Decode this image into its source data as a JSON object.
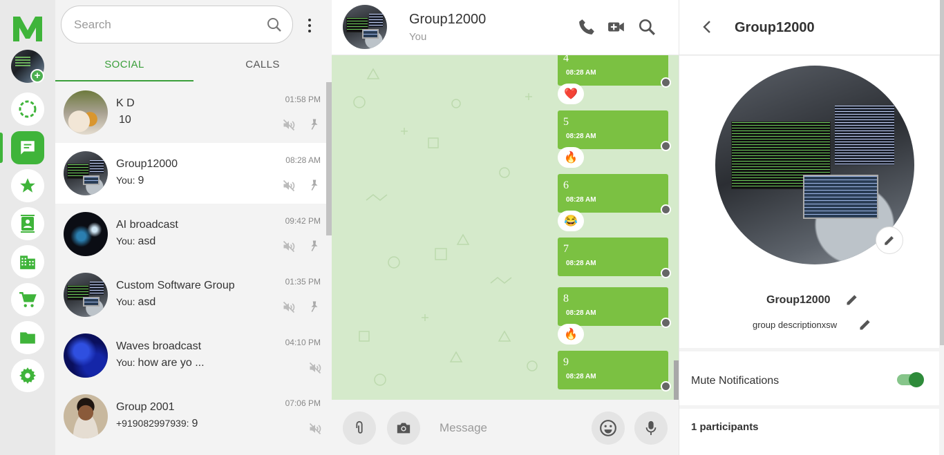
{
  "colors": {
    "brand_green": "#3fb43a",
    "bubble_green": "#7bc142",
    "chat_bg": "#d5eacb",
    "panel_bg": "#f3f3f3"
  },
  "rail": {
    "logo_letter": "M",
    "items": [
      {
        "icon": "status-ring-icon"
      },
      {
        "icon": "chat-icon",
        "active": true
      },
      {
        "icon": "star-icon"
      },
      {
        "icon": "contacts-icon"
      },
      {
        "icon": "building-icon"
      },
      {
        "icon": "cart-icon"
      },
      {
        "icon": "folder-icon"
      },
      {
        "icon": "gear-icon"
      }
    ]
  },
  "search": {
    "placeholder": "Search"
  },
  "tabs": {
    "social": "SOCIAL",
    "calls": "CALLS"
  },
  "conversations": [
    {
      "name": "K D",
      "you": "",
      "preview": "10",
      "time": "01:58 PM",
      "muted": true,
      "pinned": true
    },
    {
      "name": "Group12000",
      "you": "You:",
      "preview": "9",
      "time": "08:28 AM",
      "muted": true,
      "pinned": true,
      "selected": true
    },
    {
      "name": "AI broadcast",
      "you": "You:",
      "preview": "asd",
      "time": "09:42 PM",
      "muted": true,
      "pinned": true
    },
    {
      "name": "Custom Software Group",
      "you": "You:",
      "preview": "asd",
      "time": "01:35 PM",
      "muted": true,
      "pinned": true
    },
    {
      "name": "Waves broadcast",
      "you": "You:",
      "preview": "how are yo ...",
      "time": "04:10 PM",
      "muted": true,
      "pinned": false
    },
    {
      "name": "Group 2001",
      "you": "+919082997939:",
      "preview": "9",
      "time": "07:06 PM",
      "muted": true,
      "pinned": false
    }
  ],
  "chat": {
    "title": "Group12000",
    "subtitle": "You",
    "messages": [
      {
        "text": "4",
        "time": "08:28 AM",
        "reaction": "❤️"
      },
      {
        "text": "5",
        "time": "08:28 AM",
        "reaction": "🔥"
      },
      {
        "text": "6",
        "time": "08:28 AM",
        "reaction": "😂"
      },
      {
        "text": "7",
        "time": "08:28 AM",
        "reaction": ""
      },
      {
        "text": "8",
        "time": "08:28 AM",
        "reaction": "🔥"
      },
      {
        "text": "9",
        "time": "08:28 AM",
        "reaction": ""
      }
    ],
    "composer_placeholder": "Message"
  },
  "info": {
    "title": "Group12000",
    "group_name": "Group12000",
    "group_description": "group descriptionxsw",
    "mute_label": "Mute Notifications",
    "mute_on": true,
    "participants": "1 participants"
  }
}
